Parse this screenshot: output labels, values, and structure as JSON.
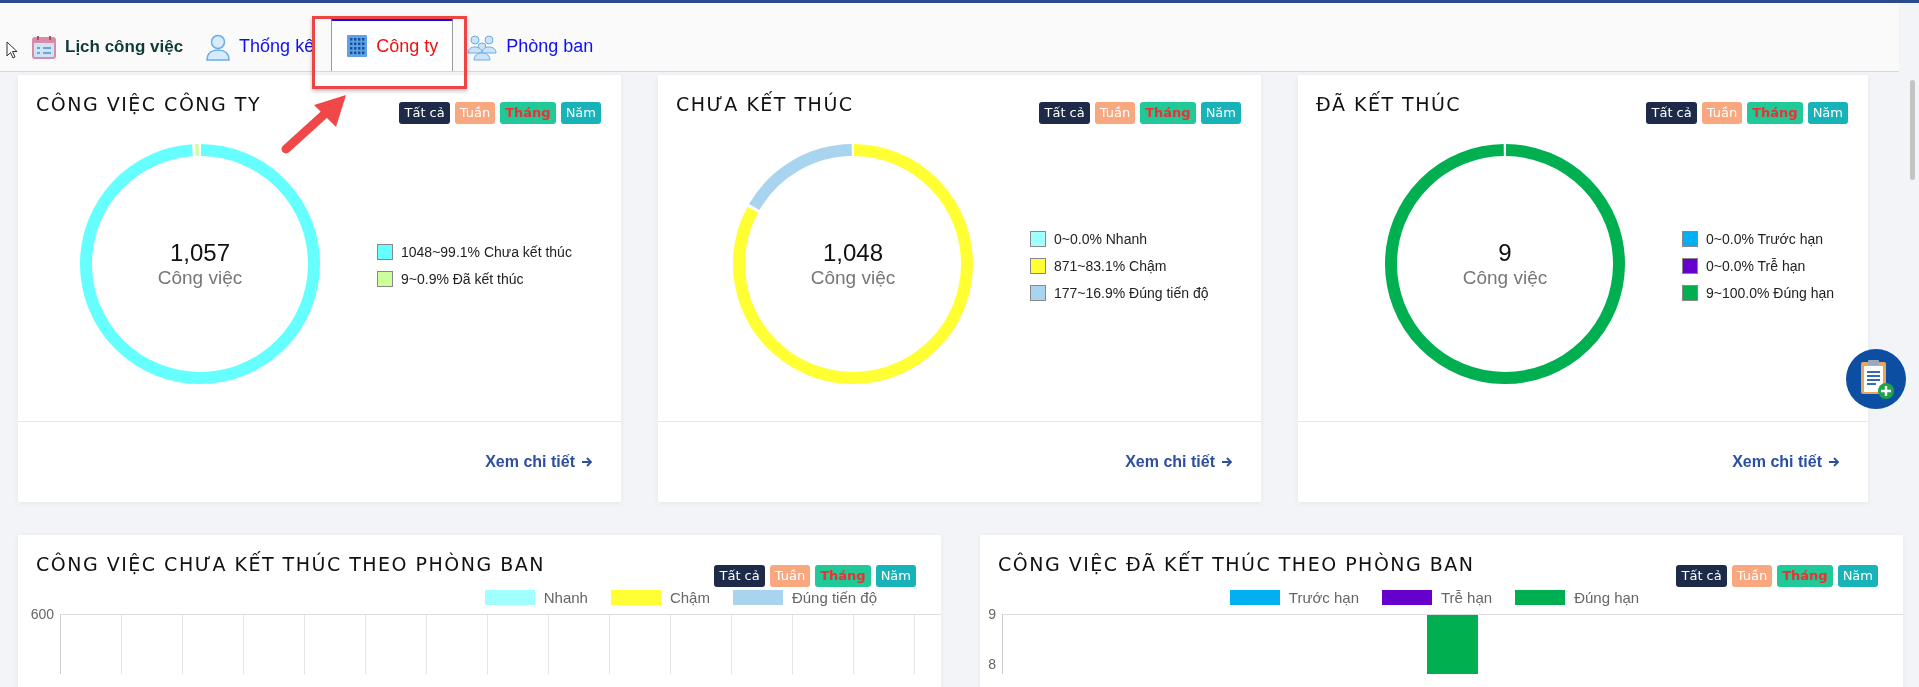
{
  "tabs": [
    {
      "label": "Lịch công việc",
      "kind": "heading",
      "selected": false
    },
    {
      "label": "Thống kê",
      "kind": "tab",
      "selected": false
    },
    {
      "label": "Công ty",
      "kind": "tab",
      "selected": true
    },
    {
      "label": "Phòng ban",
      "kind": "tab",
      "selected": false
    }
  ],
  "summary_cards": [
    {
      "title": "CÔNG VIỆC CÔNG TY",
      "filters": [
        {
          "label": "Tất cả",
          "color": "#1d2a48",
          "selected": false
        },
        {
          "label": "Tuần",
          "color": "#f8a77f",
          "selected": false
        },
        {
          "label": "Tháng",
          "color": "#20c997",
          "selected": true
        },
        {
          "label": "Năm",
          "color": "#17b3b8",
          "selected": false
        }
      ],
      "total": "1,057",
      "unit": "Công việc",
      "legend": [
        {
          "label": "1048~99.1% Chưa kết thúc",
          "color": "#66ffff",
          "level": 0.991
        },
        {
          "label": "9~0.9% Đã kết thúc",
          "color": "#ccff99",
          "level": 0.009
        }
      ],
      "link": "Xem chi tiết"
    },
    {
      "title": "CHƯA KẾT THÚC",
      "filters": [
        {
          "label": "Tất cả",
          "color": "#1d2a48",
          "selected": false
        },
        {
          "label": "Tuần",
          "color": "#f8a77f",
          "selected": false
        },
        {
          "label": "Tháng",
          "color": "#20c997",
          "selected": true
        },
        {
          "label": "Năm",
          "color": "#17b3b8",
          "selected": false
        }
      ],
      "total": "1,048",
      "unit": "Công việc",
      "legend": [
        {
          "label": "0~0.0% Nhanh",
          "color": "#a0ffff"
        },
        {
          "label": "871~83.1% Chậm",
          "color": "#ffff33",
          "level": 0.831
        },
        {
          "label": "177~16.9% Đúng tiến độ",
          "color": "#a9d4ef",
          "level": 0.169
        }
      ],
      "link": "Xem chi tiết"
    },
    {
      "title": "ĐÃ KẾT THÚC",
      "filters": [
        {
          "label": "Tất cả",
          "color": "#1d2a48",
          "selected": false
        },
        {
          "label": "Tuần",
          "color": "#f8a77f",
          "selected": false
        },
        {
          "label": "Tháng",
          "color": "#20c997",
          "selected": true
        },
        {
          "label": "Năm",
          "color": "#17b3b8",
          "selected": false
        }
      ],
      "total": "9",
      "unit": "Công việc",
      "legend": [
        {
          "label": "0~0.0% Trước hạn",
          "color": "#00b0f0"
        },
        {
          "label": "0~0.0% Trễ hạn",
          "color": "#6600cc"
        },
        {
          "label": "9~100.0% Đúng hạn",
          "color": "#00b050",
          "level": 1
        }
      ],
      "link": "Xem chi tiết"
    }
  ],
  "chart_cards": [
    {
      "title": "CÔNG VIỆC CHƯA KẾT THÚC THEO PHÒNG BAN",
      "filters": [
        {
          "label": "Tất cả",
          "color": "#1d2a48",
          "selected": false
        },
        {
          "label": "Tuần",
          "color": "#f8a77f",
          "selected": false
        },
        {
          "label": "Tháng",
          "color": "#20c997",
          "selected": true
        },
        {
          "label": "Năm",
          "color": "#17b3b8",
          "selected": false
        }
      ],
      "legend": [
        {
          "label": "Nhanh",
          "color": "#a0ffff"
        },
        {
          "label": "Chậm",
          "color": "#ffff33"
        },
        {
          "label": "Đúng tiến độ",
          "color": "#a9d4ef"
        }
      ],
      "y_ticks": [
        "600"
      ]
    },
    {
      "title": "CÔNG VIỆC ĐÃ KẾT THÚC THEO PHÒNG BAN",
      "filters": [
        {
          "label": "Tất cả",
          "color": "#1d2a48",
          "selected": false
        },
        {
          "label": "Tuần",
          "color": "#f8a77f",
          "selected": false
        },
        {
          "label": "Tháng",
          "color": "#20c997",
          "selected": true
        },
        {
          "label": "Năm",
          "color": "#17b3b8",
          "selected": false
        }
      ],
      "legend": [
        {
          "label": "Trước hạn",
          "color": "#00b0f0"
        },
        {
          "label": "Trễ hạn",
          "color": "#6600cc"
        },
        {
          "label": "Đúng hạn",
          "color": "#00b050"
        }
      ],
      "y_ticks": [
        "9",
        "8"
      ]
    }
  ]
}
